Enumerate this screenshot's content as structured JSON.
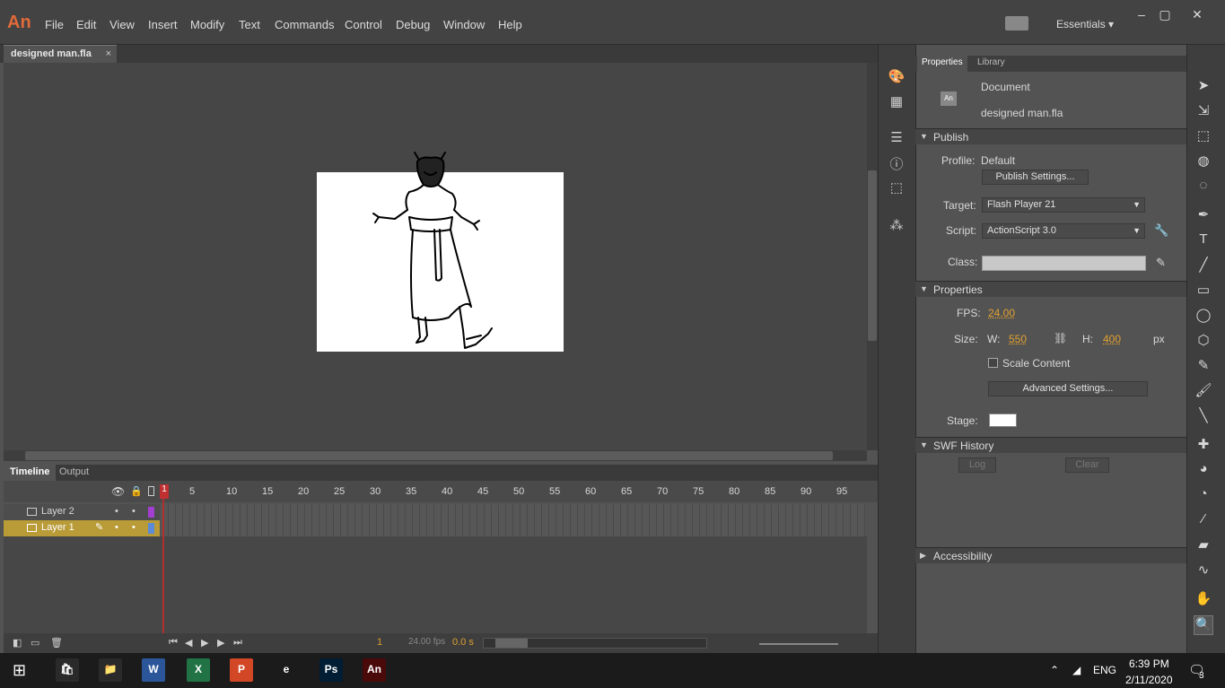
{
  "app": {
    "logo": "An"
  },
  "menu": [
    "File",
    "Edit",
    "View",
    "Insert",
    "Modify",
    "Text",
    "Commands",
    "Control",
    "Debug",
    "Window",
    "Help"
  ],
  "workspace": {
    "label": "Essentials ▾"
  },
  "window_controls": {
    "minimize": "–",
    "maximize": "▢",
    "close": "✕"
  },
  "document_tab": {
    "name": "designed man.fla",
    "close": "×"
  },
  "timeline": {
    "tabs": [
      "Timeline",
      "Output"
    ],
    "frame_numbers": [
      "1",
      "5",
      "10",
      "15",
      "20",
      "25",
      "30",
      "35",
      "40",
      "45",
      "50",
      "55",
      "60",
      "65",
      "70",
      "75",
      "80",
      "85",
      "90",
      "95"
    ],
    "layers": [
      {
        "name": "Layer 2",
        "color": "#a23fd1",
        "selected": false
      },
      {
        "name": "Layer 1",
        "color": "#5a8ad8",
        "selected": true
      }
    ],
    "footer": {
      "current_frame": "1",
      "fps": "24.00 fps",
      "time": "0.0 s"
    }
  },
  "properties": {
    "tabs": [
      "Properties",
      "Library"
    ],
    "doc_icon": "An",
    "doc_type": "Document",
    "doc_name": "designed man.fla",
    "publish": {
      "header": "Publish",
      "profile_label": "Profile:",
      "profile_value": "Default",
      "settings_button": "Publish Settings...",
      "target_label": "Target:",
      "target_value": "Flash Player 21",
      "script_label": "Script:",
      "script_value": "ActionScript 3.0",
      "class_label": "Class:"
    },
    "props": {
      "header": "Properties",
      "fps_label": "FPS:",
      "fps_value": "24.00",
      "size_label": "Size:",
      "w_label": "W:",
      "w_value": "550",
      "h_label": "H:",
      "h_value": "400",
      "unit": "px",
      "scale_label": "Scale Content",
      "advanced_button": "Advanced Settings...",
      "stage_label": "Stage:",
      "stage_color": "#ffffff"
    },
    "swf_history": {
      "header": "SWF History",
      "log": "Log",
      "clear": "Clear"
    },
    "accessibility": {
      "header": "Accessibility"
    }
  },
  "taskbar": {
    "time": "6:39 PM",
    "date": "2/11/2020",
    "lang": "ENG",
    "notifications": "3",
    "apps": [
      {
        "name": "store",
        "label": "🛍",
        "color": "#2a2a2a"
      },
      {
        "name": "explorer",
        "label": "📁",
        "color": "#2a2a2a"
      },
      {
        "name": "word",
        "label": "W",
        "color": "#2b579a"
      },
      {
        "name": "excel",
        "label": "X",
        "color": "#217346"
      },
      {
        "name": "powerpoint",
        "label": "P",
        "color": "#d24726"
      },
      {
        "name": "edge",
        "label": "e",
        "color": "#1b1b1b"
      },
      {
        "name": "photoshop",
        "label": "Ps",
        "color": "#001d34"
      },
      {
        "name": "animate",
        "label": "An",
        "color": "#4a0a0a"
      }
    ]
  }
}
